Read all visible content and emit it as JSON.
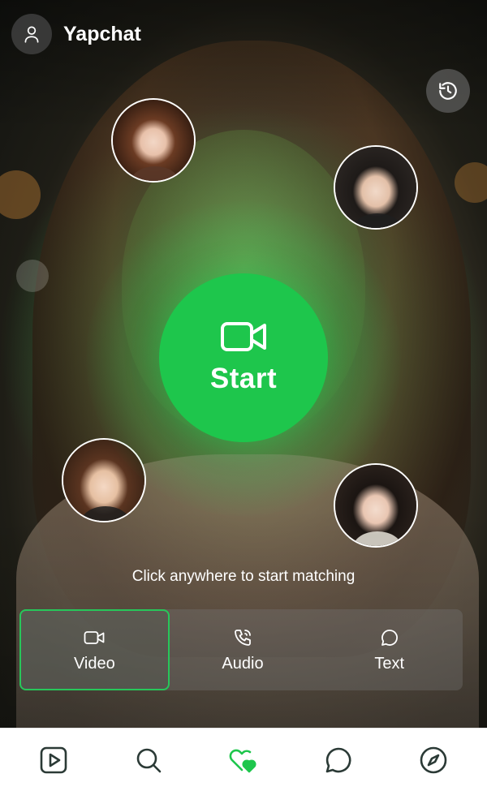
{
  "app": {
    "title": "Yapchat"
  },
  "start": {
    "label": "Start"
  },
  "hint": "Click anywhere to start matching",
  "modes": [
    {
      "label": "Video",
      "icon": "video-icon",
      "active": true
    },
    {
      "label": "Audio",
      "icon": "phone-call-icon",
      "active": false
    },
    {
      "label": "Text",
      "icon": "chat-bubble-icon",
      "active": false
    }
  ],
  "nav": [
    {
      "icon": "play-square-icon",
      "active": false
    },
    {
      "icon": "search-icon",
      "active": false
    },
    {
      "icon": "hearts-icon",
      "active": true
    },
    {
      "icon": "chat-bubble-icon",
      "active": false
    },
    {
      "icon": "compass-icon",
      "active": false
    }
  ],
  "colors": {
    "accent": "#1ec64c",
    "nav_icon": "#2b3a36",
    "nav_active": "#1ec64c"
  }
}
